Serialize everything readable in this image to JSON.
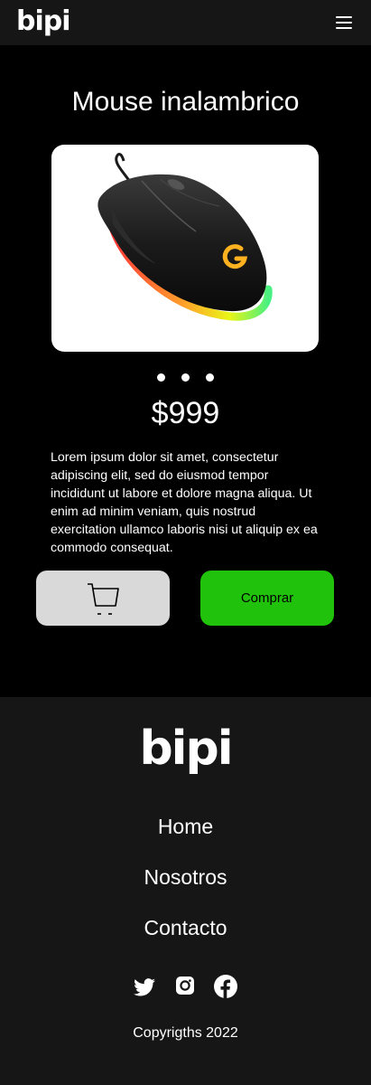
{
  "header": {
    "logo": "bipi",
    "menu_icon": "hamburger-menu-icon"
  },
  "product": {
    "title": "Mouse inalambrico",
    "image_icon": "gaming-mouse-image",
    "carousel": {
      "count": 3
    },
    "price": "$999",
    "description": "Lorem ipsum dolor sit amet, consectetur adipiscing elit, sed do eiusmod tempor incididunt ut labore et dolore magna aliqua. Ut enim ad minim veniam, quis nostrud exercitation ullamco laboris nisi ut aliquip ex ea commodo consequat.",
    "cart_icon": "shopping-cart-icon",
    "buy_label": "Comprar"
  },
  "footer": {
    "logo": "bipi",
    "links": [
      "Home",
      "Nosotros",
      "Contacto"
    ],
    "social": [
      "twitter-icon",
      "instagram-icon",
      "facebook-icon"
    ],
    "copyright": "Copyrigths 2022"
  },
  "colors": {
    "background": "#000000",
    "bar": "#161616",
    "accent_green": "#21c20b",
    "cart_button": "#d9d9d9"
  }
}
